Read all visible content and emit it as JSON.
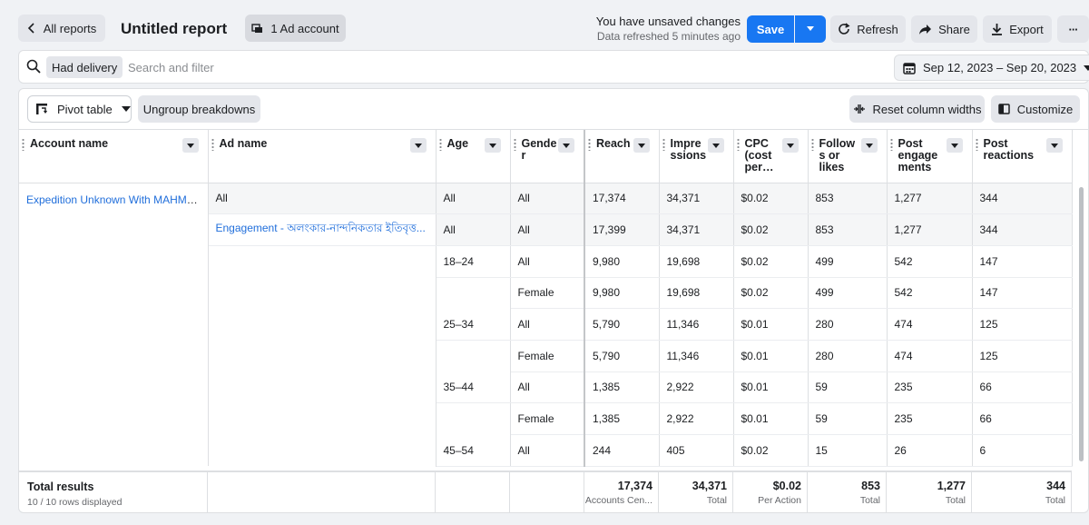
{
  "header": {
    "back_label": "All reports",
    "title": "Untitled report",
    "ad_account_label": "1 Ad account",
    "unsaved_text": "You have unsaved changes",
    "refreshed_text": "Data refreshed 5 minutes ago",
    "save_label": "Save",
    "refresh_label": "Refresh",
    "share_label": "Share",
    "export_label": "Export",
    "more_label": "···"
  },
  "filter": {
    "chip_label": "Had delivery",
    "search_placeholder": "Search and filter",
    "date_range": "Sep 12, 2023 – Sep 20, 2023"
  },
  "toolbar": {
    "pivot_label": "Pivot table",
    "ungroup_label": "Ungroup breakdowns",
    "reset_label": "Reset column widths",
    "customize_label": "Customize"
  },
  "columns": [
    "Account name",
    "Ad name",
    "Age",
    "Gende r",
    "Reach",
    "Impre ssions",
    "CPC (cost per…",
    "Follow s or likes",
    "Post engage ments",
    "Post reactions"
  ],
  "column_lines": [
    [
      "Account name"
    ],
    [
      "Ad name"
    ],
    [
      "Age"
    ],
    [
      "Gende",
      "r"
    ],
    [
      "Reach"
    ],
    [
      "Impre",
      "ssions"
    ],
    [
      "CPC",
      "(cost",
      "per…"
    ],
    [
      "Follow",
      "s or",
      "likes"
    ],
    [
      "Post",
      "engage",
      "ments"
    ],
    [
      "Post",
      "reactions"
    ]
  ],
  "account_name": "Expedition Unknown With MAHMUD",
  "rows": [
    {
      "ad": "All",
      "age": "All",
      "gender": "All",
      "reach": "17,374",
      "impr": "34,371",
      "cpc": "$0.02",
      "follows": "853",
      "eng": "1,277",
      "react": "344"
    },
    {
      "ad": "Engagement - অলংকার-নান্দনিকতার ইতিবৃত্ত...",
      "age": "All",
      "gender": "All",
      "reach": "17,399",
      "impr": "34,371",
      "cpc": "$0.02",
      "follows": "853",
      "eng": "1,277",
      "react": "344"
    },
    {
      "ad": "",
      "age": "18–24",
      "gender": "All",
      "reach": "9,980",
      "impr": "19,698",
      "cpc": "$0.02",
      "follows": "499",
      "eng": "542",
      "react": "147"
    },
    {
      "ad": "",
      "age": "",
      "gender": "Female",
      "reach": "9,980",
      "impr": "19,698",
      "cpc": "$0.02",
      "follows": "499",
      "eng": "542",
      "react": "147"
    },
    {
      "ad": "",
      "age": "25–34",
      "gender": "All",
      "reach": "5,790",
      "impr": "11,346",
      "cpc": "$0.01",
      "follows": "280",
      "eng": "474",
      "react": "125"
    },
    {
      "ad": "",
      "age": "",
      "gender": "Female",
      "reach": "5,790",
      "impr": "11,346",
      "cpc": "$0.01",
      "follows": "280",
      "eng": "474",
      "react": "125"
    },
    {
      "ad": "",
      "age": "35–44",
      "gender": "All",
      "reach": "1,385",
      "impr": "2,922",
      "cpc": "$0.01",
      "follows": "59",
      "eng": "235",
      "react": "66"
    },
    {
      "ad": "",
      "age": "",
      "gender": "Female",
      "reach": "1,385",
      "impr": "2,922",
      "cpc": "$0.01",
      "follows": "59",
      "eng": "235",
      "react": "66"
    },
    {
      "ad": "",
      "age": "45–54",
      "gender": "All",
      "reach": "244",
      "impr": "405",
      "cpc": "$0.02",
      "follows": "15",
      "eng": "26",
      "react": "6"
    }
  ],
  "totals": {
    "title": "Total results",
    "subtitle": "10 / 10 rows displayed",
    "reach": {
      "value": "17,374",
      "sub": "Accounts Cen..."
    },
    "impr": {
      "value": "34,371",
      "sub": "Total"
    },
    "cpc": {
      "value": "$0.02",
      "sub": "Per Action"
    },
    "follows": {
      "value": "853",
      "sub": "Total"
    },
    "eng": {
      "value": "1,277",
      "sub": "Total"
    },
    "react": {
      "value": "344",
      "sub": "Total"
    }
  },
  "colors": {
    "accent": "#1877f2",
    "link": "#216fdb"
  }
}
